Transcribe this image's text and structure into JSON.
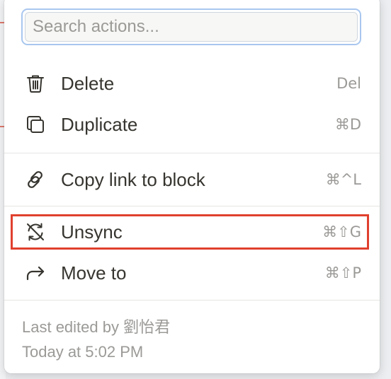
{
  "search": {
    "placeholder": "Search actions..."
  },
  "actions": [
    {
      "label": "Delete",
      "shortcut": "Del",
      "icon": "trash-icon"
    },
    {
      "label": "Duplicate",
      "shortcut": "⌘D",
      "icon": "duplicate-icon"
    },
    {
      "label": "Copy link to block",
      "shortcut": "⌘^L",
      "icon": "link-icon"
    },
    {
      "label": "Unsync",
      "shortcut": "⌘⇧G",
      "icon": "unsync-icon"
    },
    {
      "label": "Move to",
      "shortcut": "⌘⇧P",
      "icon": "move-arrow-icon"
    }
  ],
  "footer": {
    "last_edited": "Last edited by 劉怡君",
    "timestamp": "Today at 5:02 PM"
  },
  "colors": {
    "highlight": "#e0402e",
    "search_focus": "#a9c7ef",
    "text": "#37352f",
    "muted": "#9b9a97"
  }
}
